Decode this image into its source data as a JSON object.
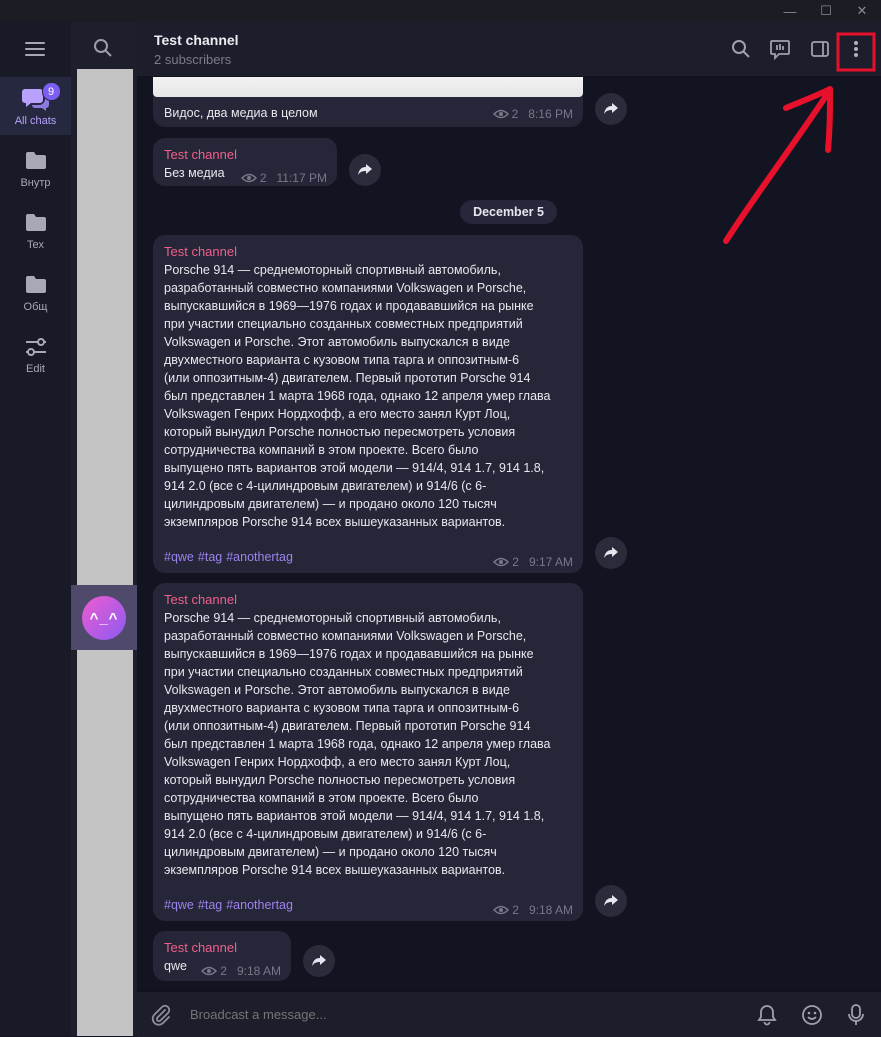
{
  "window": {
    "minimize_glyph": "—",
    "maximize_glyph": "☐",
    "close_glyph": "✕"
  },
  "folders": [
    {
      "label": "All chats",
      "badge": "9",
      "icon": "chats-icon",
      "active": true
    },
    {
      "label": "Внутр",
      "icon": "folder-icon"
    },
    {
      "label": "Tex",
      "icon": "folder-icon"
    },
    {
      "label": "Общ",
      "icon": "folder-icon"
    },
    {
      "label": "Edit",
      "icon": "sliders-icon"
    }
  ],
  "chat_list": {
    "selected_avatar_text": "^_^"
  },
  "header": {
    "title": "Test channel",
    "subtitle": "2 subscribers"
  },
  "messages": [
    {
      "text": "Видос, два медиа в целом",
      "views": "2",
      "time": "8:16 PM"
    },
    {
      "sender": "Test channel",
      "text": "Без медиа",
      "views": "2",
      "time": "11:17 PM"
    },
    {
      "sender": "Test channel",
      "text": "Porsche 914 — среднемоторный спортивный автомобиль,\nразработанный совместно компаниями Volkswagen и Porsche,\nвыпускавшийся в 1969—1976 годах и продававшийся на рынке\nпри участии специально созданных совместных предприятий\nVolkswagen и Porsche. Этот автомобиль выпускался в виде\nдвухместного варианта с кузовом типа тарга и оппозитным-6\n(или оппозитным-4) двигателем. Первый прототип Porsche 914\nбыл представлен 1 марта 1968 года, однако 12 апреля умер глава\nVolkswagen Генрих Нордхофф, а его место занял Курт Лоц,\nкоторый вынудил Porsche полностью пересмотреть условия\nсотрудничества компаний в этом проекте. Всего было\nвыпущено пять вариантов этой модели — 914/4, 914 1.7, 914 1.8,\n914 2.0 (все с 4-цилиндровым двигателем) и 914/6 (с 6-\nцилиндровым двигателем) — и продано около 120 тысяч\nэкземпляров Porsche 914 всех вышеуказанных вариантов.",
      "tags": [
        "#qwe",
        "#tag",
        "#anothertag"
      ],
      "views": "2",
      "time": "9:17 AM"
    },
    {
      "sender": "Test channel",
      "text": "Porsche 914 — среднемоторный спортивный автомобиль,\nразработанный совместно компаниями Volkswagen и Porsche,\nвыпускавшийся в 1969—1976 годах и продававшийся на рынке\nпри участии специально созданных совместных предприятий\nVolkswagen и Porsche. Этот автомобиль выпускался в виде\nдвухместного варианта с кузовом типа тарга и оппозитным-6\n(или оппозитным-4) двигателем. Первый прототип Porsche 914\nбыл представлен 1 марта 1968 года, однако 12 апреля умер глава\nVolkswagen Генрих Нордхофф, а его место занял Курт Лоц,\nкоторый вынудил Porsche полностью пересмотреть условия\nсотрудничества компаний в этом проекте. Всего было\nвыпущено пять вариантов этой модели — 914/4, 914 1.7, 914 1.8,\n914 2.0 (все с 4-цилиндровым двигателем) и 914/6 (с 6-\nцилиндровым двигателем) — и продано около 120 тысяч\nэкземпляров Porsche 914 всех вышеуказанных вариантов.",
      "tags": [
        "#qwe",
        "#tag",
        "#anothertag"
      ],
      "views": "2",
      "time": "9:18 AM"
    },
    {
      "sender": "Test channel",
      "text": "qwe",
      "views": "2",
      "time": "9:18 AM"
    }
  ],
  "date_separator": "December 5",
  "composer": {
    "placeholder": "Broadcast a message..."
  },
  "colors": {
    "accent": "#7c5ef2",
    "sender": "#f0608c",
    "hashtag": "#9d83ee",
    "annotation": "#e8112b"
  }
}
